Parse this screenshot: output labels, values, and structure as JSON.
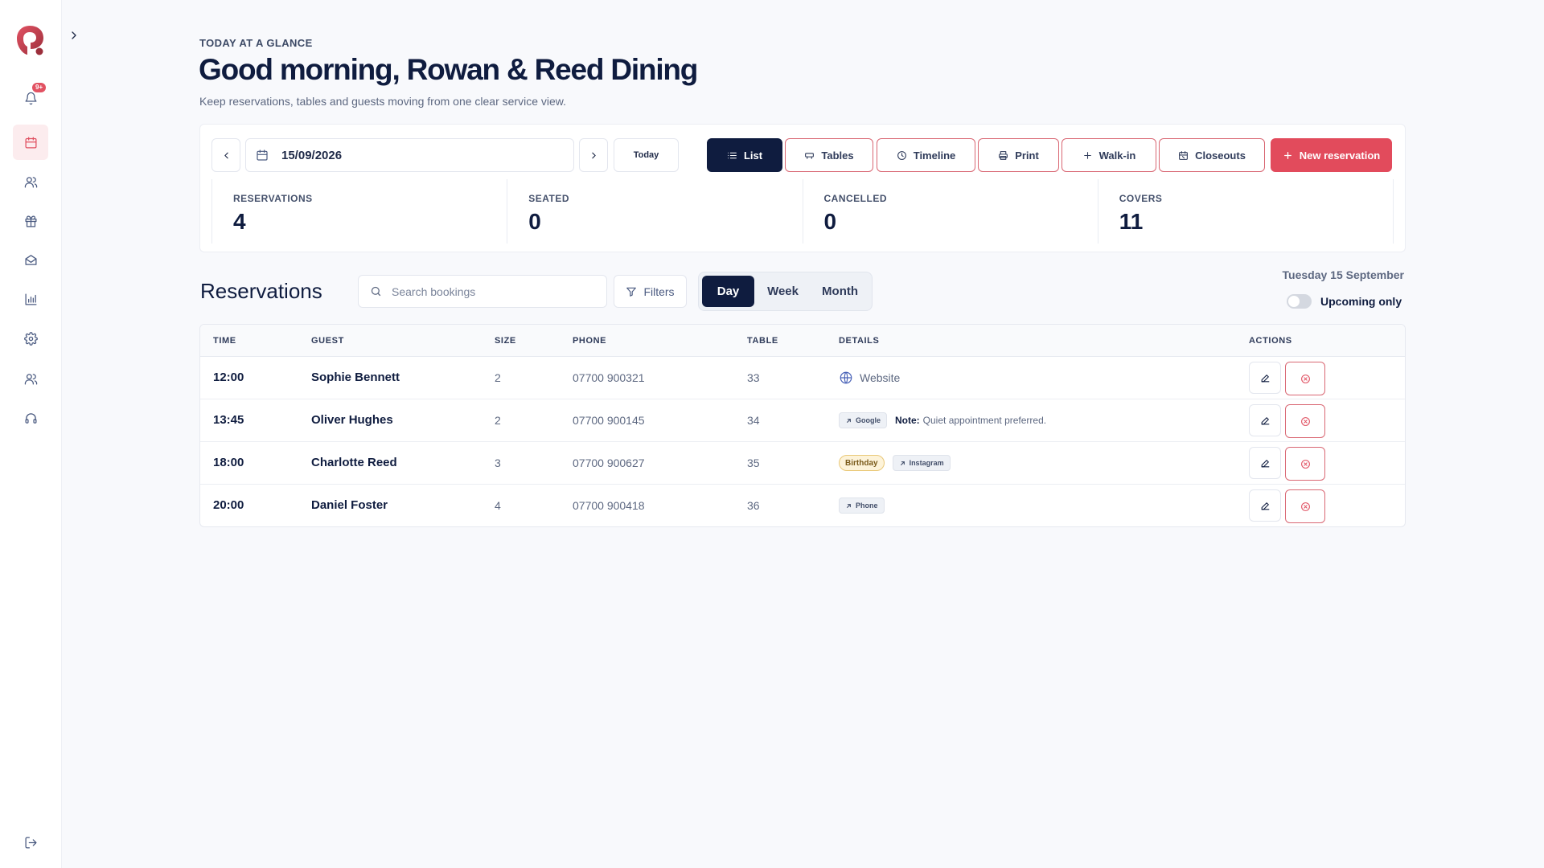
{
  "sidebar": {
    "notification_badge": "9+",
    "items": [
      {
        "name": "bell-icon"
      },
      {
        "name": "calendar-icon",
        "active": true
      },
      {
        "name": "users-icon"
      },
      {
        "name": "gift-icon"
      },
      {
        "name": "mail-icon"
      },
      {
        "name": "chart-icon"
      },
      {
        "name": "settings-icon"
      },
      {
        "name": "team-icon"
      },
      {
        "name": "headset-icon"
      }
    ],
    "logout_icon": "logout-icon"
  },
  "header": {
    "eyebrow": "TODAY AT A GLANCE",
    "title": "Good morning, Rowan & Reed Dining",
    "subtitle": "Keep reservations, tables and guests moving from one clear service view."
  },
  "controls": {
    "date_value": "15/09/2026",
    "today_label": "Today",
    "list_label": "List",
    "tables_label": "Tables",
    "timeline_label": "Timeline",
    "print_label": "Print",
    "walkin_label": "Walk-in",
    "closeouts_label": "Closeouts",
    "new_reservation_label": "New reservation"
  },
  "stats": [
    {
      "label": "RESERVATIONS",
      "value": "4"
    },
    {
      "label": "SEATED",
      "value": "0"
    },
    {
      "label": "CANCELLED",
      "value": "0"
    },
    {
      "label": "COVERS",
      "value": "11"
    }
  ],
  "reservations": {
    "title": "Reservations",
    "search_placeholder": "Search bookings",
    "filters_label": "Filters",
    "views": [
      "Day",
      "Week",
      "Month"
    ],
    "active_view": "Day",
    "date_label": "Tuesday 15 September",
    "upcoming_label": "Upcoming only",
    "upcoming_on": false,
    "columns": {
      "time": "TIME",
      "guest": "GUEST",
      "size": "SIZE",
      "phone": "PHONE",
      "table": "TABLE",
      "details": "DETAILS",
      "actions": "ACTIONS"
    },
    "rows": [
      {
        "time": "12:00",
        "guest": "Sophie Bennett",
        "size": "2",
        "phone": "07700 900321",
        "table": "33",
        "source": "Website"
      },
      {
        "time": "13:45",
        "guest": "Oliver Hughes",
        "size": "2",
        "phone": "07700 900145",
        "table": "34",
        "source": "Google",
        "note_label": "Note:",
        "note": "Quiet appointment preferred."
      },
      {
        "time": "18:00",
        "guest": "Charlotte Reed",
        "size": "3",
        "phone": "07700 900627",
        "table": "35",
        "tag": "Birthday",
        "source": "Instagram"
      },
      {
        "time": "20:00",
        "guest": "Daniel Foster",
        "size": "4",
        "phone": "07700 900418",
        "table": "36",
        "source": "Phone"
      }
    ]
  },
  "colors": {
    "navy": "#0f1c3f",
    "accent_red": "#e24b5c",
    "background": "#f8f9fc"
  }
}
